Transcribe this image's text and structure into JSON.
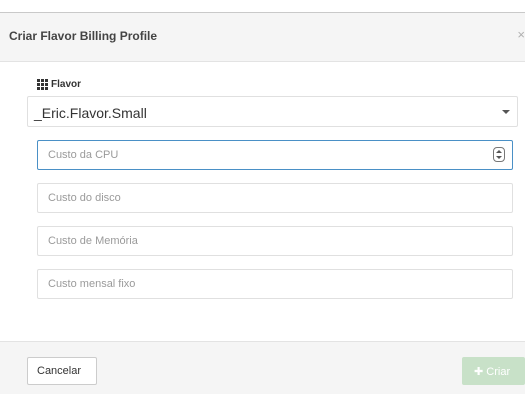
{
  "modal": {
    "title": "Criar Flavor Billing Profile",
    "close_glyph": "×"
  },
  "flavor": {
    "label": "Flavor",
    "label_icon": "grid-icon",
    "selected_value": "_Eric.Flavor.Small"
  },
  "fields": {
    "cpu_cost": {
      "placeholder": "Custo da CPU",
      "value": ""
    },
    "disk_cost": {
      "placeholder": "Custo do disco",
      "value": ""
    },
    "memory_cost": {
      "placeholder": "Custo de Memória",
      "value": ""
    },
    "monthly_fixed_cost": {
      "placeholder": "Custo mensal fixo",
      "value": ""
    }
  },
  "footer": {
    "cancel_label": "Cancelar",
    "create_label": "Criar",
    "create_icon": "plus-icon"
  },
  "colors": {
    "focus_border": "#4a90c6",
    "create_button_disabled": "#c8e1c8",
    "header_bg": "#f5f5f5"
  }
}
